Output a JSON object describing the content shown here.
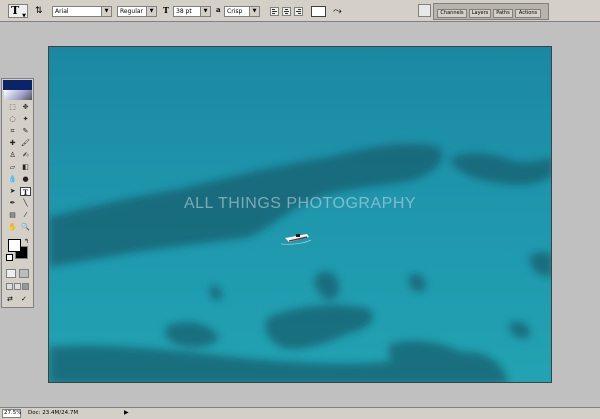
{
  "options_bar": {
    "tool_preset_glyph": "T",
    "font_family": "Arial",
    "font_style": "Regular",
    "font_size": "38 pt",
    "antialias": "Crisp",
    "text_color": "#ffffff",
    "icons": [
      "text-orientation-icon",
      "font-size-icon",
      "antialias-icon",
      "align-left-icon",
      "align-center-icon",
      "align-right-icon",
      "warp-text-icon",
      "file-browser-icon"
    ]
  },
  "palette_well": {
    "tabs": [
      "Channels",
      "Layers",
      "Paths",
      "Actions"
    ]
  },
  "document": {
    "watermark": "ALL THINGS PHOTOGRAPHY",
    "water_color": "#1c8da6",
    "reef_color": "#135f6e"
  },
  "toolbox": {
    "active_tool": "T",
    "foreground_color": "#ffffff",
    "background_color": "#000000",
    "tools": [
      {
        "name": "marquee-tool-icon",
        "glyph": "⬚"
      },
      {
        "name": "move-tool-icon",
        "glyph": "✥"
      },
      {
        "name": "lasso-tool-icon",
        "glyph": "◌"
      },
      {
        "name": "magic-wand-tool-icon",
        "glyph": "✦"
      },
      {
        "name": "crop-tool-icon",
        "glyph": "⌗"
      },
      {
        "name": "slice-tool-icon",
        "glyph": "✎"
      },
      {
        "name": "healing-brush-tool-icon",
        "glyph": "✚"
      },
      {
        "name": "brush-tool-icon",
        "glyph": "🖌"
      },
      {
        "name": "clone-stamp-tool-icon",
        "glyph": "♙"
      },
      {
        "name": "history-brush-tool-icon",
        "glyph": "✍"
      },
      {
        "name": "eraser-tool-icon",
        "glyph": "▱"
      },
      {
        "name": "gradient-tool-icon",
        "glyph": "◧"
      },
      {
        "name": "blur-tool-icon",
        "glyph": "💧"
      },
      {
        "name": "dodge-tool-icon",
        "glyph": "●"
      },
      {
        "name": "path-selection-tool-icon",
        "glyph": "➤"
      },
      {
        "name": "type-tool-icon",
        "glyph": "T"
      },
      {
        "name": "pen-tool-icon",
        "glyph": "✒"
      },
      {
        "name": "line-tool-icon",
        "glyph": "╲"
      },
      {
        "name": "notes-tool-icon",
        "glyph": "▤"
      },
      {
        "name": "eyedropper-tool-icon",
        "glyph": "⁄"
      },
      {
        "name": "hand-tool-icon",
        "glyph": "✋"
      },
      {
        "name": "zoom-tool-icon",
        "glyph": "🔍"
      }
    ]
  },
  "status_bar": {
    "zoom": "27.5%",
    "doc_info": "Doc: 23.4M/24.7M"
  }
}
